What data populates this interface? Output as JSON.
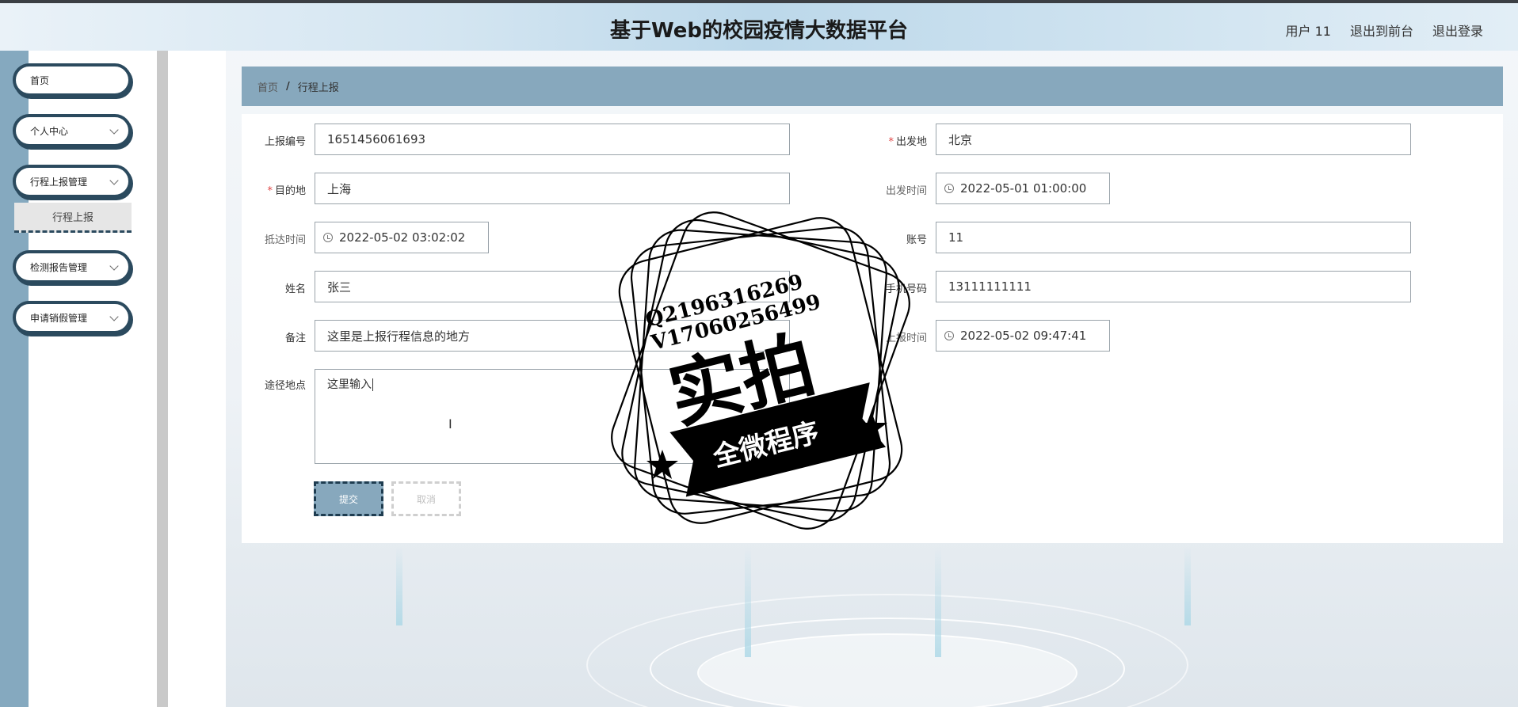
{
  "header": {
    "title": "基于Web的校园疫情大数据平台",
    "user_label": "用户 11",
    "back_to_front": "退出到前台",
    "logout": "退出登录"
  },
  "sidebar": {
    "items": [
      {
        "label": "首页",
        "has_chevron": false
      },
      {
        "label": "个人中心",
        "has_chevron": true
      },
      {
        "label": "行程上报管理",
        "has_chevron": true
      },
      {
        "label": "检测报告管理",
        "has_chevron": true
      },
      {
        "label": "申请销假管理",
        "has_chevron": true
      }
    ],
    "active_subitem": "行程上报"
  },
  "breadcrumb": {
    "home": "首页",
    "separator": "/",
    "current": "行程上报"
  },
  "form": {
    "report_no": {
      "label": "上报编号",
      "value": "1651456061693"
    },
    "departure": {
      "label": "出发地",
      "value": "北京",
      "required": true
    },
    "destination": {
      "label": "目的地",
      "value": "上海",
      "required": true
    },
    "depart_time": {
      "label": "出发时间",
      "value": "2022-05-01 01:00:00"
    },
    "arrive_time": {
      "label": "抵达时间",
      "value": "2022-05-02 03:02:02"
    },
    "account": {
      "label": "账号",
      "value": "11"
    },
    "name": {
      "label": "姓名",
      "value": "张三"
    },
    "phone": {
      "label": "手机号码",
      "value": "13111111111"
    },
    "remark": {
      "label": "备注",
      "value": "这里是上报行程信息的地方"
    },
    "report_time": {
      "label": "上报时间",
      "value": "2022-05-02 09:47:41"
    },
    "via": {
      "label": "途径地点",
      "value": "这里输入"
    },
    "submit_label": "提交",
    "cancel_label": "取消"
  },
  "watermark": {
    "qq": "Q2196316269",
    "wechat": "V17060256499",
    "big_text": "实拍",
    "ribbon_text": "全微程序"
  },
  "colors": {
    "accent": "#87a8bd",
    "accent_dark": "#2b4a5e",
    "required": "#e04646"
  }
}
